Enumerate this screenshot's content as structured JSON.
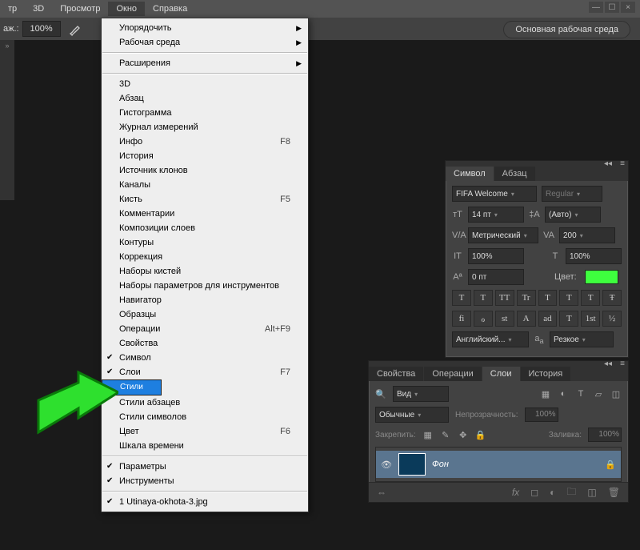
{
  "menubar": {
    "items": [
      "тр",
      "3D",
      "Просмотр",
      "Окно",
      "Справка"
    ],
    "active_index": 3
  },
  "toolbar": {
    "zoom_label": "аж.:",
    "zoom_value": "100%",
    "workspace_btn": "Основная рабочая среда"
  },
  "dropdown": {
    "items": [
      {
        "label": "Упорядочить",
        "submenu": true
      },
      {
        "label": "Рабочая среда",
        "submenu": true
      },
      {
        "sep": true
      },
      {
        "label": "Расширения",
        "submenu": true
      },
      {
        "sep": true
      },
      {
        "label": "3D"
      },
      {
        "label": "Абзац"
      },
      {
        "label": "Гистограмма"
      },
      {
        "label": "Журнал измерений"
      },
      {
        "label": "Инфо",
        "shortcut": "F8"
      },
      {
        "label": "История"
      },
      {
        "label": "Источник клонов"
      },
      {
        "label": "Каналы"
      },
      {
        "label": "Кисть",
        "shortcut": "F5"
      },
      {
        "label": "Комментарии"
      },
      {
        "label": "Композиции слоев"
      },
      {
        "label": "Контуры"
      },
      {
        "label": "Коррекция"
      },
      {
        "label": "Наборы кистей"
      },
      {
        "label": "Наборы параметров для инструментов"
      },
      {
        "label": "Навигатор"
      },
      {
        "label": "Образцы"
      },
      {
        "label": "Операции",
        "shortcut": "Alt+F9"
      },
      {
        "label": "Свойства"
      },
      {
        "label": "Символ",
        "checked": true
      },
      {
        "label": "Слои",
        "checked": true,
        "shortcut": "F7"
      },
      {
        "label": "Стили",
        "selected": true
      },
      {
        "label": "Стили абзацев"
      },
      {
        "label": "Стили символов"
      },
      {
        "label": "Цвет",
        "shortcut": "F6"
      },
      {
        "label": "Шкала времени"
      },
      {
        "sep": true
      },
      {
        "label": "Параметры",
        "checked": true
      },
      {
        "label": "Инструменты",
        "checked": true
      },
      {
        "sep": true
      },
      {
        "label": "1 Utinaya-okhota-3.jpg",
        "checked": true
      }
    ]
  },
  "char_panel": {
    "tab1": "Символ",
    "tab2": "Абзац",
    "font": "FIFA Welcome",
    "style": "Regular",
    "size": "14 пт",
    "leading": "(Авто)",
    "tracking_mode": "Метрический",
    "tracking": "200",
    "vscale": "100%",
    "hscale": "100%",
    "baseline": "0 пт",
    "color_label": "Цвет:",
    "type_btns": [
      "T",
      "T",
      "TT",
      "Tr",
      "T",
      "T",
      "T",
      "Ŧ"
    ],
    "ot_btns": [
      "fi",
      "ℴ",
      "st",
      "A",
      "ad",
      "T",
      "1st",
      "½"
    ],
    "lang": "Английский...",
    "aa": "Резкое"
  },
  "layers_panel": {
    "tabs": [
      "Свойства",
      "Операции",
      "Слои",
      "История"
    ],
    "active_tab": 2,
    "filter": "Вид",
    "blend": "Обычные",
    "opacity_label": "Непрозрачность:",
    "opacity": "100%",
    "lock_label": "Закрепить:",
    "fill_label": "Заливка:",
    "fill": "100%",
    "layer_name": "Фон"
  }
}
